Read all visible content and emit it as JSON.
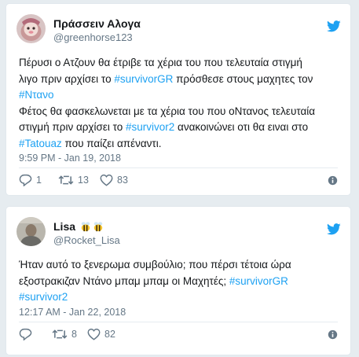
{
  "tweets": [
    {
      "name": "Πράσσειν Αλογα",
      "handle": "@greenhorse123",
      "lines": [
        [
          {
            "t": "Πέρυσι ο Ατζουν θα έτριβε τα χέρια του που τελευταία στιγμή"
          }
        ],
        [
          {
            "t": "λιγο πριν αρχίσει το "
          },
          {
            "t": "#survivorGR",
            "tag": true
          },
          {
            "t": " πρόσθεσε στους μαχητες τον"
          }
        ],
        [
          {
            "t": "#Ντανο",
            "tag": true
          }
        ],
        [
          {
            "t": "Φέτος θα φασκελωνεται με τα χέρια του που οΝτανος τελευταία"
          }
        ],
        [
          {
            "t": "στιγμή πριν αρχίσει το "
          },
          {
            "t": "#survivor2",
            "tag": true
          },
          {
            "t": " ανακοινώνει οτι θα ειναι στο"
          }
        ],
        [
          {
            "t": "#Tatouaz",
            "tag": true
          },
          {
            "t": " που παίζει απέναντι."
          }
        ]
      ],
      "timestamp": "9:59 PM - Jan 19, 2018",
      "replies": "1",
      "retweets": "13",
      "likes": "83"
    },
    {
      "name": "Lisa",
      "name_emoji": [
        "bee",
        "bee"
      ],
      "handle": "@Rocket_Lisa",
      "lines": [
        [
          {
            "t": "Ήταν αυτό το ξενερωμα συμβούλιο; που πέρσι τέτοια ώρα"
          }
        ],
        [
          {
            "t": "εξοστρακιζαν Ντάνο μπαμ μπαμ οι Μαχητές; "
          },
          {
            "t": "#survivorGR",
            "tag": true
          }
        ],
        [
          {
            "t": "#survivor2",
            "tag": true
          }
        ]
      ],
      "timestamp": "12:17 AM - Jan 22, 2018",
      "replies": "",
      "retweets": "8",
      "likes": "82"
    }
  ],
  "colors": {
    "accent": "#1da1f2",
    "muted": "#657786",
    "text": "#14171a",
    "bg": "#e6ecf0"
  },
  "icons": [
    "twitter-bird-icon",
    "reply-icon",
    "retweet-icon",
    "like-icon",
    "info-icon",
    "bee-emoji-icon"
  ]
}
